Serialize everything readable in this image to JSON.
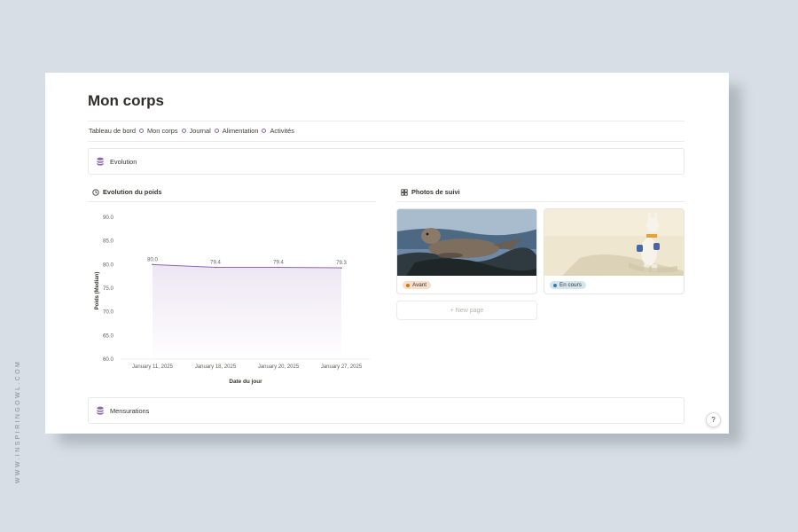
{
  "watermark": "WWW.INSPIRINGOWL.COM",
  "page": {
    "title": "Mon corps",
    "breadcrumb": [
      "Tableau de bord",
      "Mon corps",
      "Journal",
      "Alimentation",
      "Activités"
    ]
  },
  "sections": {
    "evolution": "Evolution",
    "mensurations": "Mensurations"
  },
  "chart_panel": {
    "title": "Evolution du poids",
    "icon": "clock-icon"
  },
  "chart_data": {
    "type": "line",
    "title": "",
    "xlabel": "Date du jour",
    "ylabel": "Poids (Median)",
    "x": [
      "January 11, 2025",
      "January 18, 2025",
      "January 20, 2025",
      "January 27, 2025"
    ],
    "series": [
      {
        "values": [
          80.0,
          79.4,
          79.4,
          79.3
        ]
      }
    ],
    "data_labels": [
      "80.0",
      "79.4",
      "79.4",
      "79.3"
    ],
    "yticks": [
      "90.0",
      "85.0",
      "80.0",
      "75.0",
      "70.0",
      "65.0",
      "60.0"
    ],
    "ylim": [
      60,
      90
    ],
    "grid": false,
    "color": "#9065b0",
    "fill": "area-gradient"
  },
  "gallery": {
    "title": "Photos de suivi",
    "icon": "grid-icon",
    "cards": [
      {
        "image": "seal-photo",
        "tag": "Avant",
        "tag_color": "#fadec9",
        "dot_color": "#d9730d"
      },
      {
        "image": "llama-toy-photo",
        "tag": "En cours",
        "tag_color": "#d3e5ef",
        "dot_color": "#337ea9"
      }
    ],
    "new_page": "+ New page"
  },
  "help_button": "?"
}
